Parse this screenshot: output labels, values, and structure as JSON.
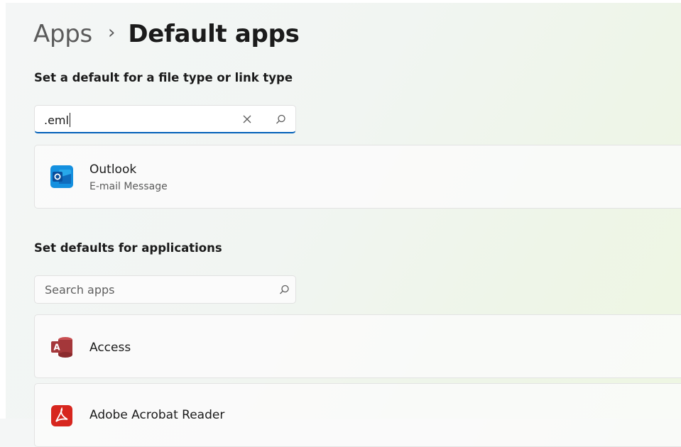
{
  "breadcrumb": {
    "parent": "Apps",
    "separator": "›",
    "current": "Default apps"
  },
  "file_type_section": {
    "title": "Set a default for a file type or link type",
    "search": {
      "value": ".eml",
      "placeholder": ""
    },
    "result": {
      "app_name": "Outlook",
      "file_description": "E-mail Message",
      "icon": "outlook-icon"
    }
  },
  "applications_section": {
    "title": "Set defaults for applications",
    "search": {
      "value": "",
      "placeholder": "Search apps"
    },
    "apps": [
      {
        "name": "Access",
        "icon": "access-icon"
      },
      {
        "name": "Adobe Acrobat Reader",
        "icon": "acrobat-reader-icon"
      }
    ]
  },
  "colors": {
    "accent": "#005fb8",
    "outlook_blue": "#0f6cbd",
    "access_red": "#a4373a",
    "acrobat_red": "#d7261e"
  }
}
